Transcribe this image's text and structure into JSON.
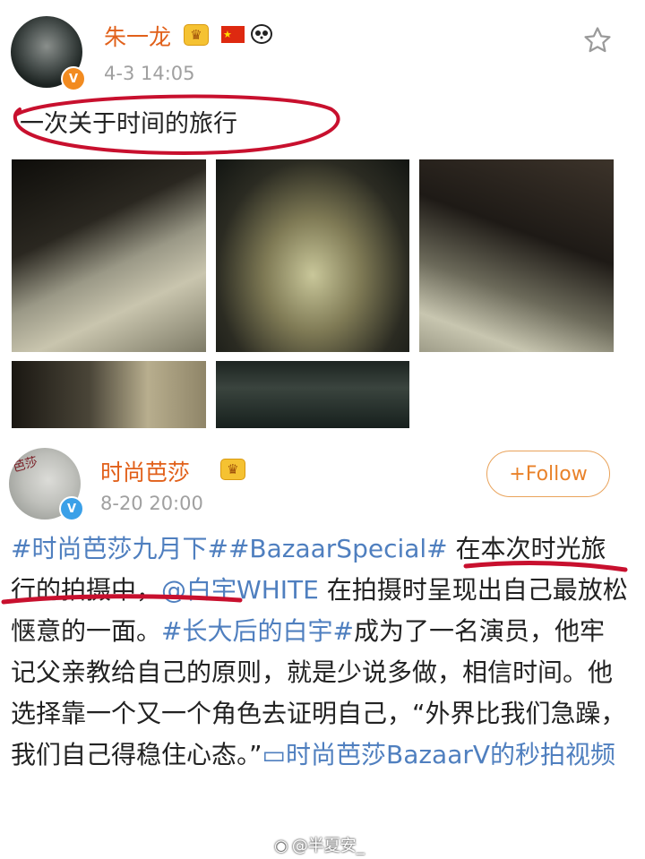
{
  "post1": {
    "username": "朱一龙",
    "timestamp": "4-3 14:05",
    "text": "一次关于时间的旅行",
    "verified_color": "#f28b20"
  },
  "post2": {
    "username": "时尚芭莎",
    "timestamp": "8-20 20:00",
    "follow_label": "+Follow",
    "verified_color": "#3aa0e8",
    "avatar_text": "芭莎",
    "body_segments": [
      {
        "type": "topic",
        "text": "#时尚芭莎九月下#"
      },
      {
        "type": "topic",
        "text": "#BazaarSpecial#"
      },
      {
        "type": "text",
        "text": " 在本次时光旅行的拍摄中，"
      },
      {
        "type": "mention",
        "text": "@白宇WHITE"
      },
      {
        "type": "text",
        "text": " 在拍摄时呈现出自己最放松惬意的一面。"
      },
      {
        "type": "topic",
        "text": "#长大后的白宇#"
      },
      {
        "type": "text",
        "text": "成为了一名演员，他牢记父亲教给自己的原则，就是少说多做，相信时间。他选择靠一个又一个角色去证明自己，“外界比我们急躁，我们自己得稳住心态。”"
      },
      {
        "type": "video",
        "text": "时尚芭莎BazaarV的秒拍视频"
      }
    ]
  },
  "watermark": "@半夏安_",
  "colors": {
    "username": "#e1601a",
    "link": "#4f7fbf",
    "annotation": "#c8102e",
    "follow": "#e9822a"
  },
  "icons": {
    "crown": "crown-icon",
    "flag": "china-flag-icon",
    "panda": "panda-icon",
    "star": "star-outline-icon",
    "video": "video-icon",
    "weibo": "weibo-logo-icon"
  }
}
